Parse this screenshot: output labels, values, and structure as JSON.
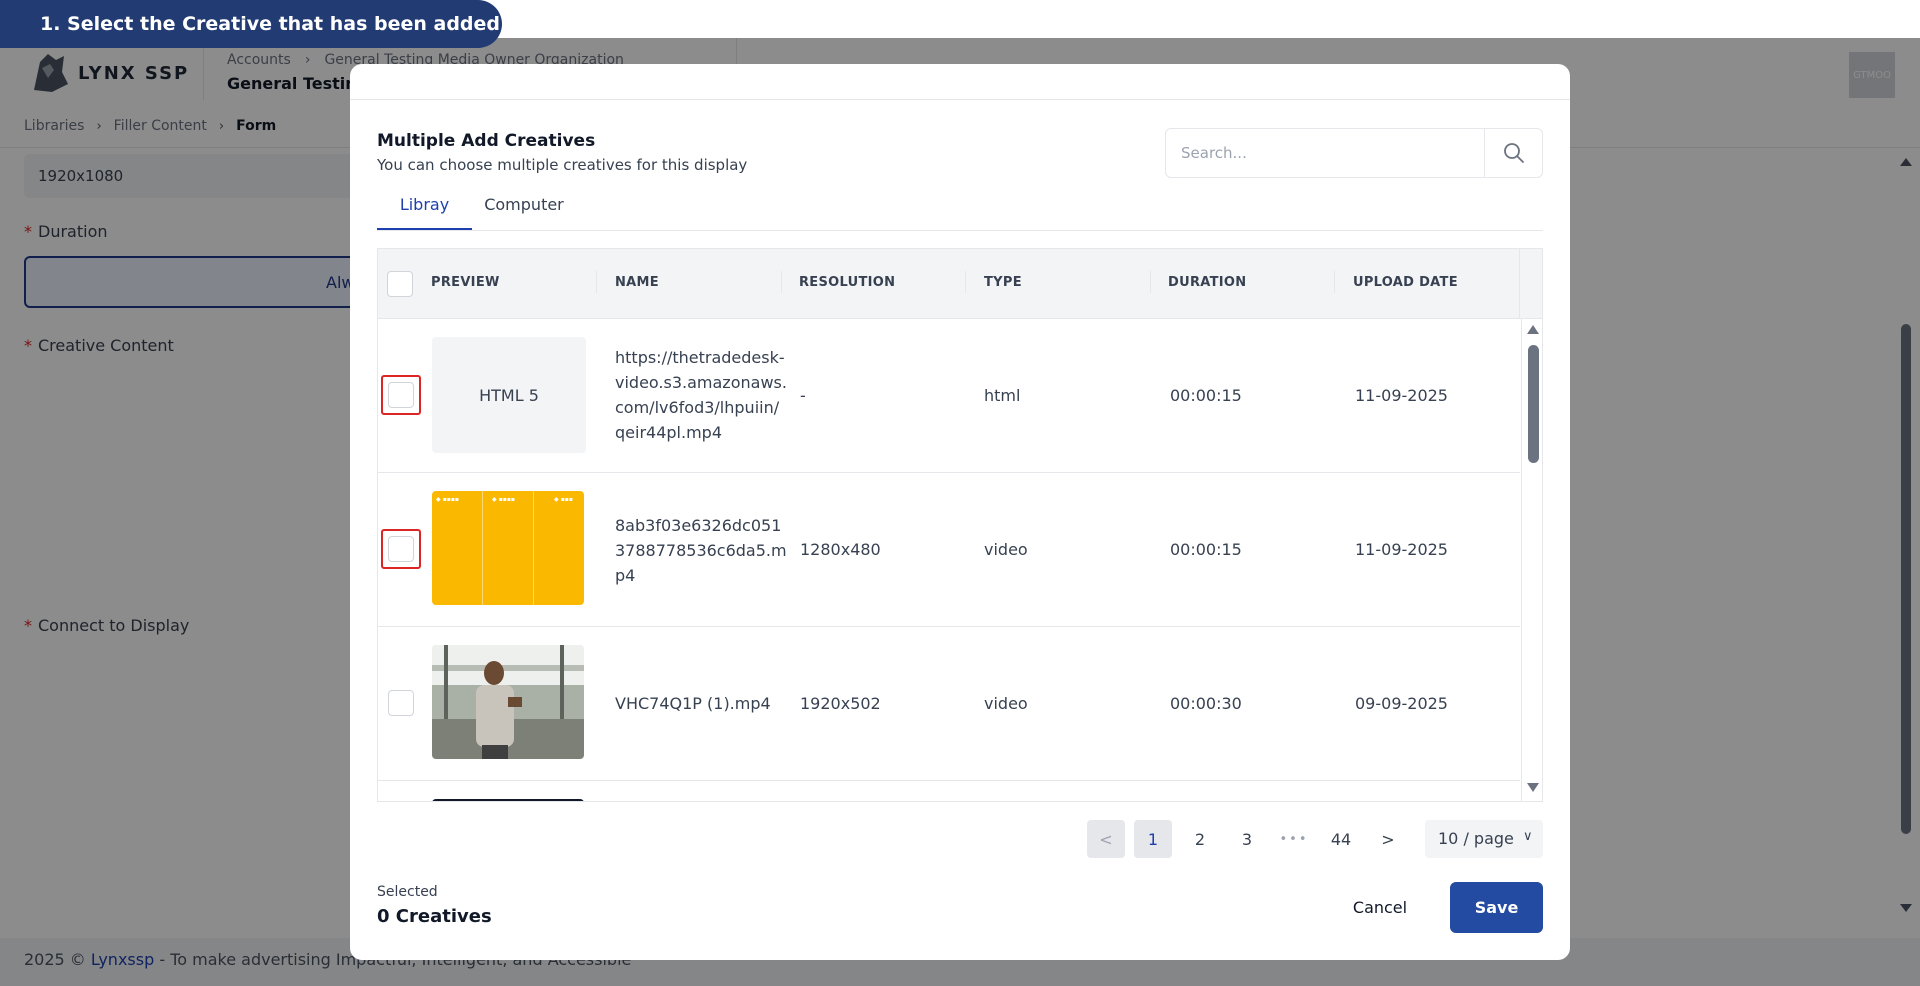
{
  "banner": {
    "text": "1. Select the Creative that has been added"
  },
  "app": {
    "logo_text": "LYNX SSP",
    "account_crumb": [
      "Accounts",
      "General Testing Media Owner Organization"
    ],
    "account_title": "General Testing",
    "avatar_text": "GTMOO",
    "breadcrumb": [
      "Libraries",
      "Filler Content",
      "Form"
    ],
    "resolution_value": "1920x1080",
    "duration_label": "Duration",
    "duration_button": "Alw",
    "creative_content_label": "Creative Content",
    "connect_label": "Connect to Display",
    "footer_prefix": "2025 © ",
    "footer_brand": "Lynxssp",
    "footer_text": " - To make advertising Impactful, Intelligent, and Accessible"
  },
  "modal": {
    "title": "Multiple Add Creatives",
    "subtitle": "You can choose multiple creatives for this display",
    "search_placeholder": "Search...",
    "tabs": [
      {
        "label": "Libray",
        "active": true
      },
      {
        "label": "Computer",
        "active": false
      }
    ],
    "columns": [
      "PREVIEW",
      "NAME",
      "RESOLUTION",
      "TYPE",
      "DURATION",
      "UPLOAD DATE"
    ],
    "rows": [
      {
        "preview": "HTML 5",
        "name": "https://thetradedesk-video.s3.amazonaws.com/lv6fod3/lhpuiin/qeir44pl.mp4",
        "resolution": "-",
        "type": "html",
        "duration": "00:00:15",
        "upload_date": "11-09-2025"
      },
      {
        "preview": "",
        "name": "8ab3f03e6326dc0513788778536c6da5.mp4",
        "resolution": "1280x480",
        "type": "video",
        "duration": "00:00:15",
        "upload_date": "11-09-2025"
      },
      {
        "preview": "",
        "name": "VHC74Q1P (1).mp4",
        "resolution": "1920x502",
        "type": "video",
        "duration": "00:00:30",
        "upload_date": "09-09-2025"
      }
    ],
    "pagination": {
      "prev": "<",
      "pages": [
        "1",
        "2",
        "3"
      ],
      "ellipsis": "•••",
      "last": "44",
      "next": ">",
      "per_page": "10 / page",
      "current": 1
    },
    "selected_label": "Selected",
    "selected_count": "0 Creatives",
    "cancel": "Cancel",
    "save": "Save",
    "colors": {
      "primary": "#234ba2",
      "highlight": "#dc2626",
      "banner": "#233b73"
    }
  }
}
